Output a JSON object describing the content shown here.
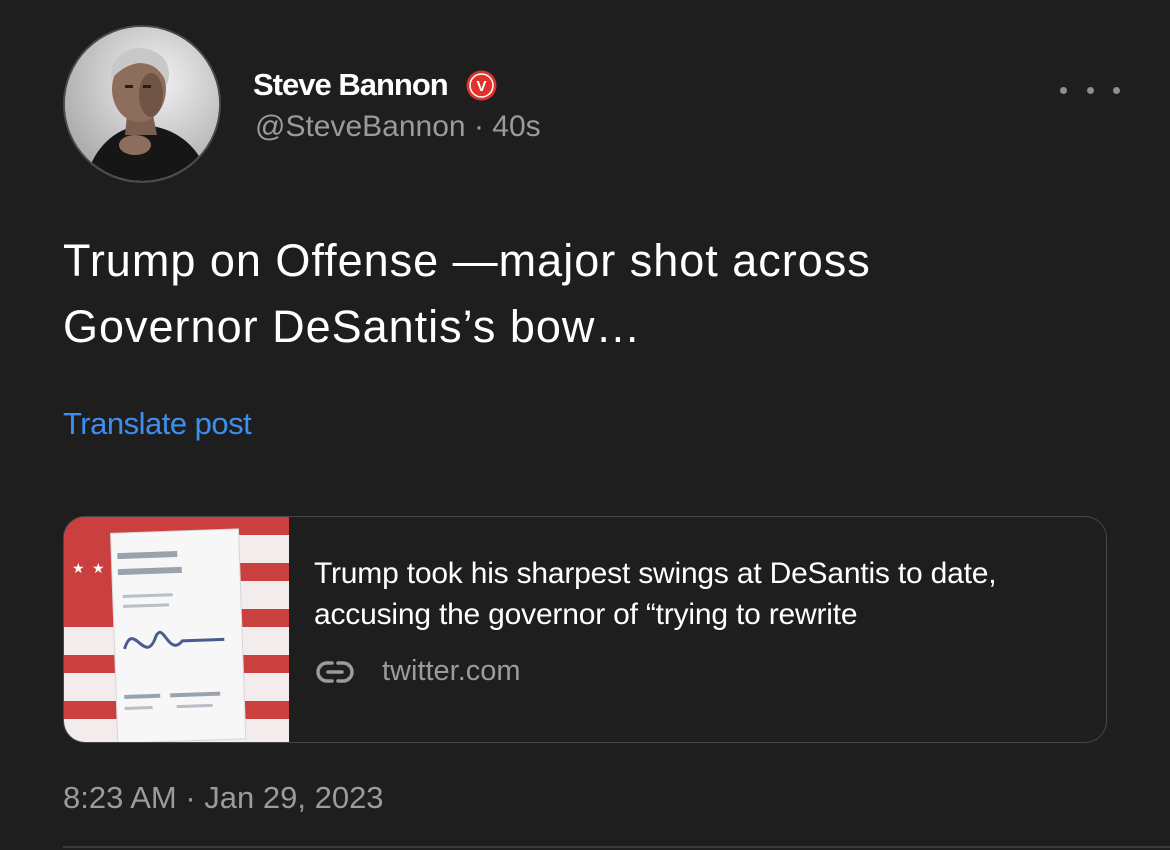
{
  "author": {
    "name": "Steve Bannon",
    "handle": "@SteveBannon",
    "separator": "·",
    "age": "40s",
    "verified_badge": "V",
    "avatar_icon": "person-portrait",
    "badge_color": "#e0322b"
  },
  "menu": {
    "icon": "more-horizontal-icon"
  },
  "post": {
    "text_line1": "Trump on Offense —major shot across",
    "text_line2": "Governor DeSantis’s bow…",
    "translate_label": "Translate post"
  },
  "link_card": {
    "title": "Trump took his sharpest swings at DeSantis to date, accusing the governor of “trying to rewrite",
    "domain": "twitter.com",
    "domain_icon": "link-icon",
    "thumbnail_icon": "book-cover-flag-image"
  },
  "footer": {
    "timestamp": "8:23 AM · Jan 29, 2023"
  },
  "colors": {
    "background": "#1e1e1f",
    "accent_link": "#3d8fef",
    "secondary_text": "#9a9a9f"
  }
}
